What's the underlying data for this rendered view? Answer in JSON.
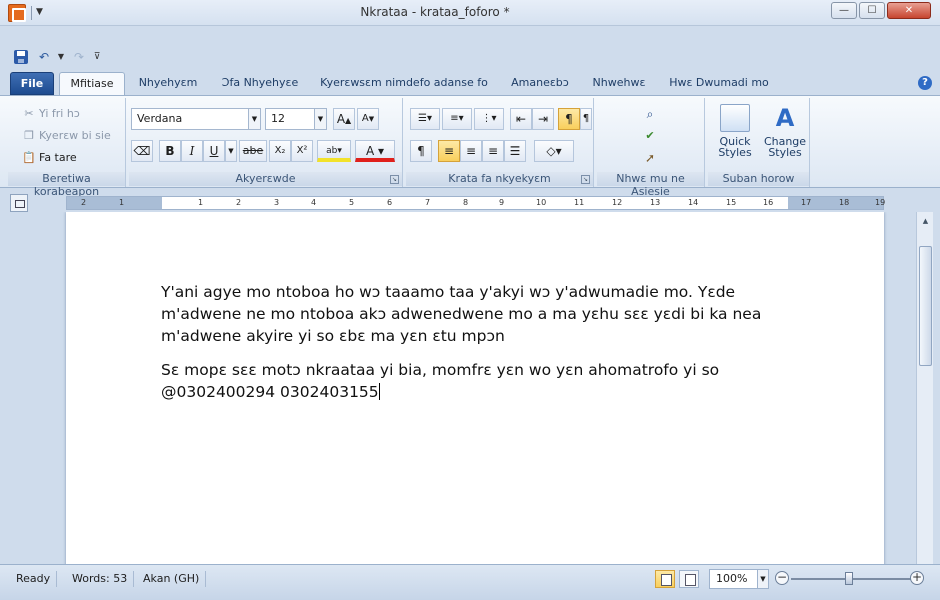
{
  "window": {
    "title": "Nkrataa - krataa_foforo *",
    "minimize": "—",
    "maximize": "☐",
    "close": "✕"
  },
  "qat": {
    "save_icon": "save-icon",
    "undo_icon": "undo-icon",
    "redo_icon": "redo-icon"
  },
  "tabs": [
    {
      "label": "File"
    },
    {
      "label": "Mfitiase"
    },
    {
      "label": "Nhyehyɛm"
    },
    {
      "label": "Ɔfa Nhyehyɛe"
    },
    {
      "label": "Kyerɛwsɛm nimdefo adanse fo"
    },
    {
      "label": "Amaneɛbɔ"
    },
    {
      "label": "Nhwehwɛ"
    },
    {
      "label": "Hwɛ Dwumadi mo"
    }
  ],
  "ribbon": {
    "clipboard": {
      "cut": "Yi fri hɔ",
      "copy": "Kyerɛw bi sie",
      "paste": "Fa tare",
      "label": "Beretiwa korabeapon"
    },
    "font": {
      "family": "Verdana",
      "size": "12",
      "bold": "B",
      "italic": "I",
      "underline": "U",
      "strike": "abe",
      "sub": "X₂",
      "sup": "X²",
      "label": "Akyerɛwde"
    },
    "paragraph": {
      "label": "Krata fa nkyekyɛm"
    },
    "editing": {
      "label": "Nhwɛ mu ne Asiesie"
    },
    "styles": {
      "quick_styles": "Quick Styles",
      "change_styles": "Change Styles",
      "label": "Suban horow"
    }
  },
  "ruler": {
    "numbers": [
      "2",
      "1",
      "1",
      "2",
      "3",
      "4",
      "5",
      "6",
      "7",
      "8",
      "9",
      "10",
      "11",
      "12",
      "13",
      "14",
      "15",
      "16",
      "17",
      "18",
      "19"
    ]
  },
  "document": {
    "paragraph1": "Y'ani agye mo ntoboa ho wɔ taaamo taa y'akyi wɔ y'adwumadie mo. Yɛde m'adwene ne mo ntoboa akɔ adwenedwene mo a ma yɛhu sɛɛ yɛdi bi ka nea m'adwene akyire yi so ɛbɛ ma yɛn ɛtu mpɔn",
    "paragraph2": "Sɛ mopɛ sɛɛ motɔ nkraataa yi bia, momfrɛ yɛn wo yɛn ahomatrofo yi so @0302400294 0302403155"
  },
  "status": {
    "ready": "Ready",
    "words": "Words: 53",
    "language": "Akan (GH)",
    "zoom": "100%",
    "zoom_level_percent": 100
  }
}
